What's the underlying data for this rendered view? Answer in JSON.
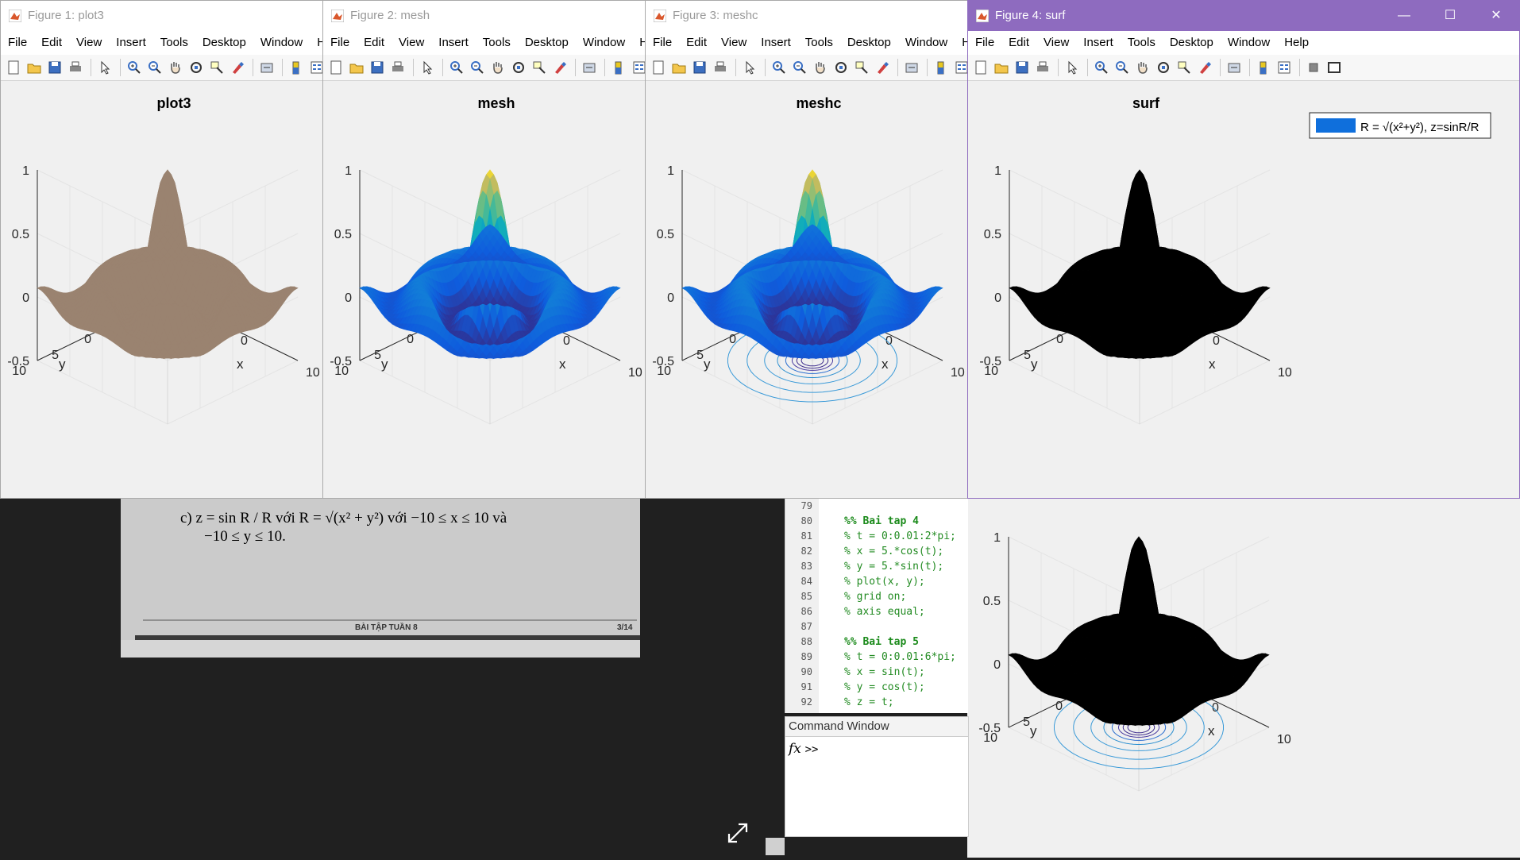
{
  "menu": [
    "File",
    "Edit",
    "View",
    "Insert",
    "Tools",
    "Desktop",
    "Window",
    "Help"
  ],
  "windows": [
    {
      "id": "fig1",
      "title": "Figure 1: plot3",
      "menu_last": "He",
      "plot_title": "plot3",
      "fill": "#9a8370"
    },
    {
      "id": "fig2",
      "title": "Figure 2: mesh",
      "menu_last": "He",
      "plot_title": "mesh",
      "fill": "parula"
    },
    {
      "id": "fig3",
      "title": "Figure 3: meshc",
      "menu_last": "He",
      "plot_title": "meshc",
      "fill": "parula"
    },
    {
      "id": "fig4",
      "title": "Figure 4: surf",
      "menu_last": "Help",
      "plot_title": "surf",
      "fill": "#000000"
    }
  ],
  "axes": {
    "z_ticks": [
      "1",
      "0.5",
      "0",
      "-0.5"
    ],
    "y_ticks": [
      "10",
      "5",
      "0",
      "-5",
      "-10"
    ],
    "x_ticks": [
      "-10",
      "0",
      "10"
    ],
    "xlabel": "x",
    "ylabel": "y"
  },
  "legend": {
    "text": "R = √(x²+y²), z=sinR/R",
    "color": "#0f6fdc"
  },
  "doc": {
    "line1": "c)  z = sin R / R  với  R = √(x² + y²)  với  −10 ≤ x ≤ 10 và",
    "line2": "−10 ≤ y ≤ 10.",
    "footer": "BÀI TẬP TUẦN 8",
    "page": "3/14"
  },
  "editor": {
    "lines": [
      {
        "n": "79",
        "code": ""
      },
      {
        "n": "80",
        "code": "%% Bai tap 4",
        "bold": true
      },
      {
        "n": "81",
        "code": "% t = 0:0.01:2*pi;"
      },
      {
        "n": "82",
        "code": "% x = 5.*cos(t);"
      },
      {
        "n": "83",
        "code": "% y = 5.*sin(t);"
      },
      {
        "n": "84",
        "code": "% plot(x, y);"
      },
      {
        "n": "85",
        "code": "% grid on;"
      },
      {
        "n": "86",
        "code": "% axis equal;"
      },
      {
        "n": "87",
        "code": ""
      },
      {
        "n": "88",
        "code": "%% Bai tap 5",
        "bold": true
      },
      {
        "n": "89",
        "code": "% t = 0:0.01:6*pi;"
      },
      {
        "n": "90",
        "code": "% x = sin(t);"
      },
      {
        "n": "91",
        "code": "% y = cos(t);"
      },
      {
        "n": "92",
        "code": "% z = t;"
      }
    ]
  },
  "command_window": {
    "title": "Command Window",
    "fx": "fx",
    "prompt": ">>"
  }
}
